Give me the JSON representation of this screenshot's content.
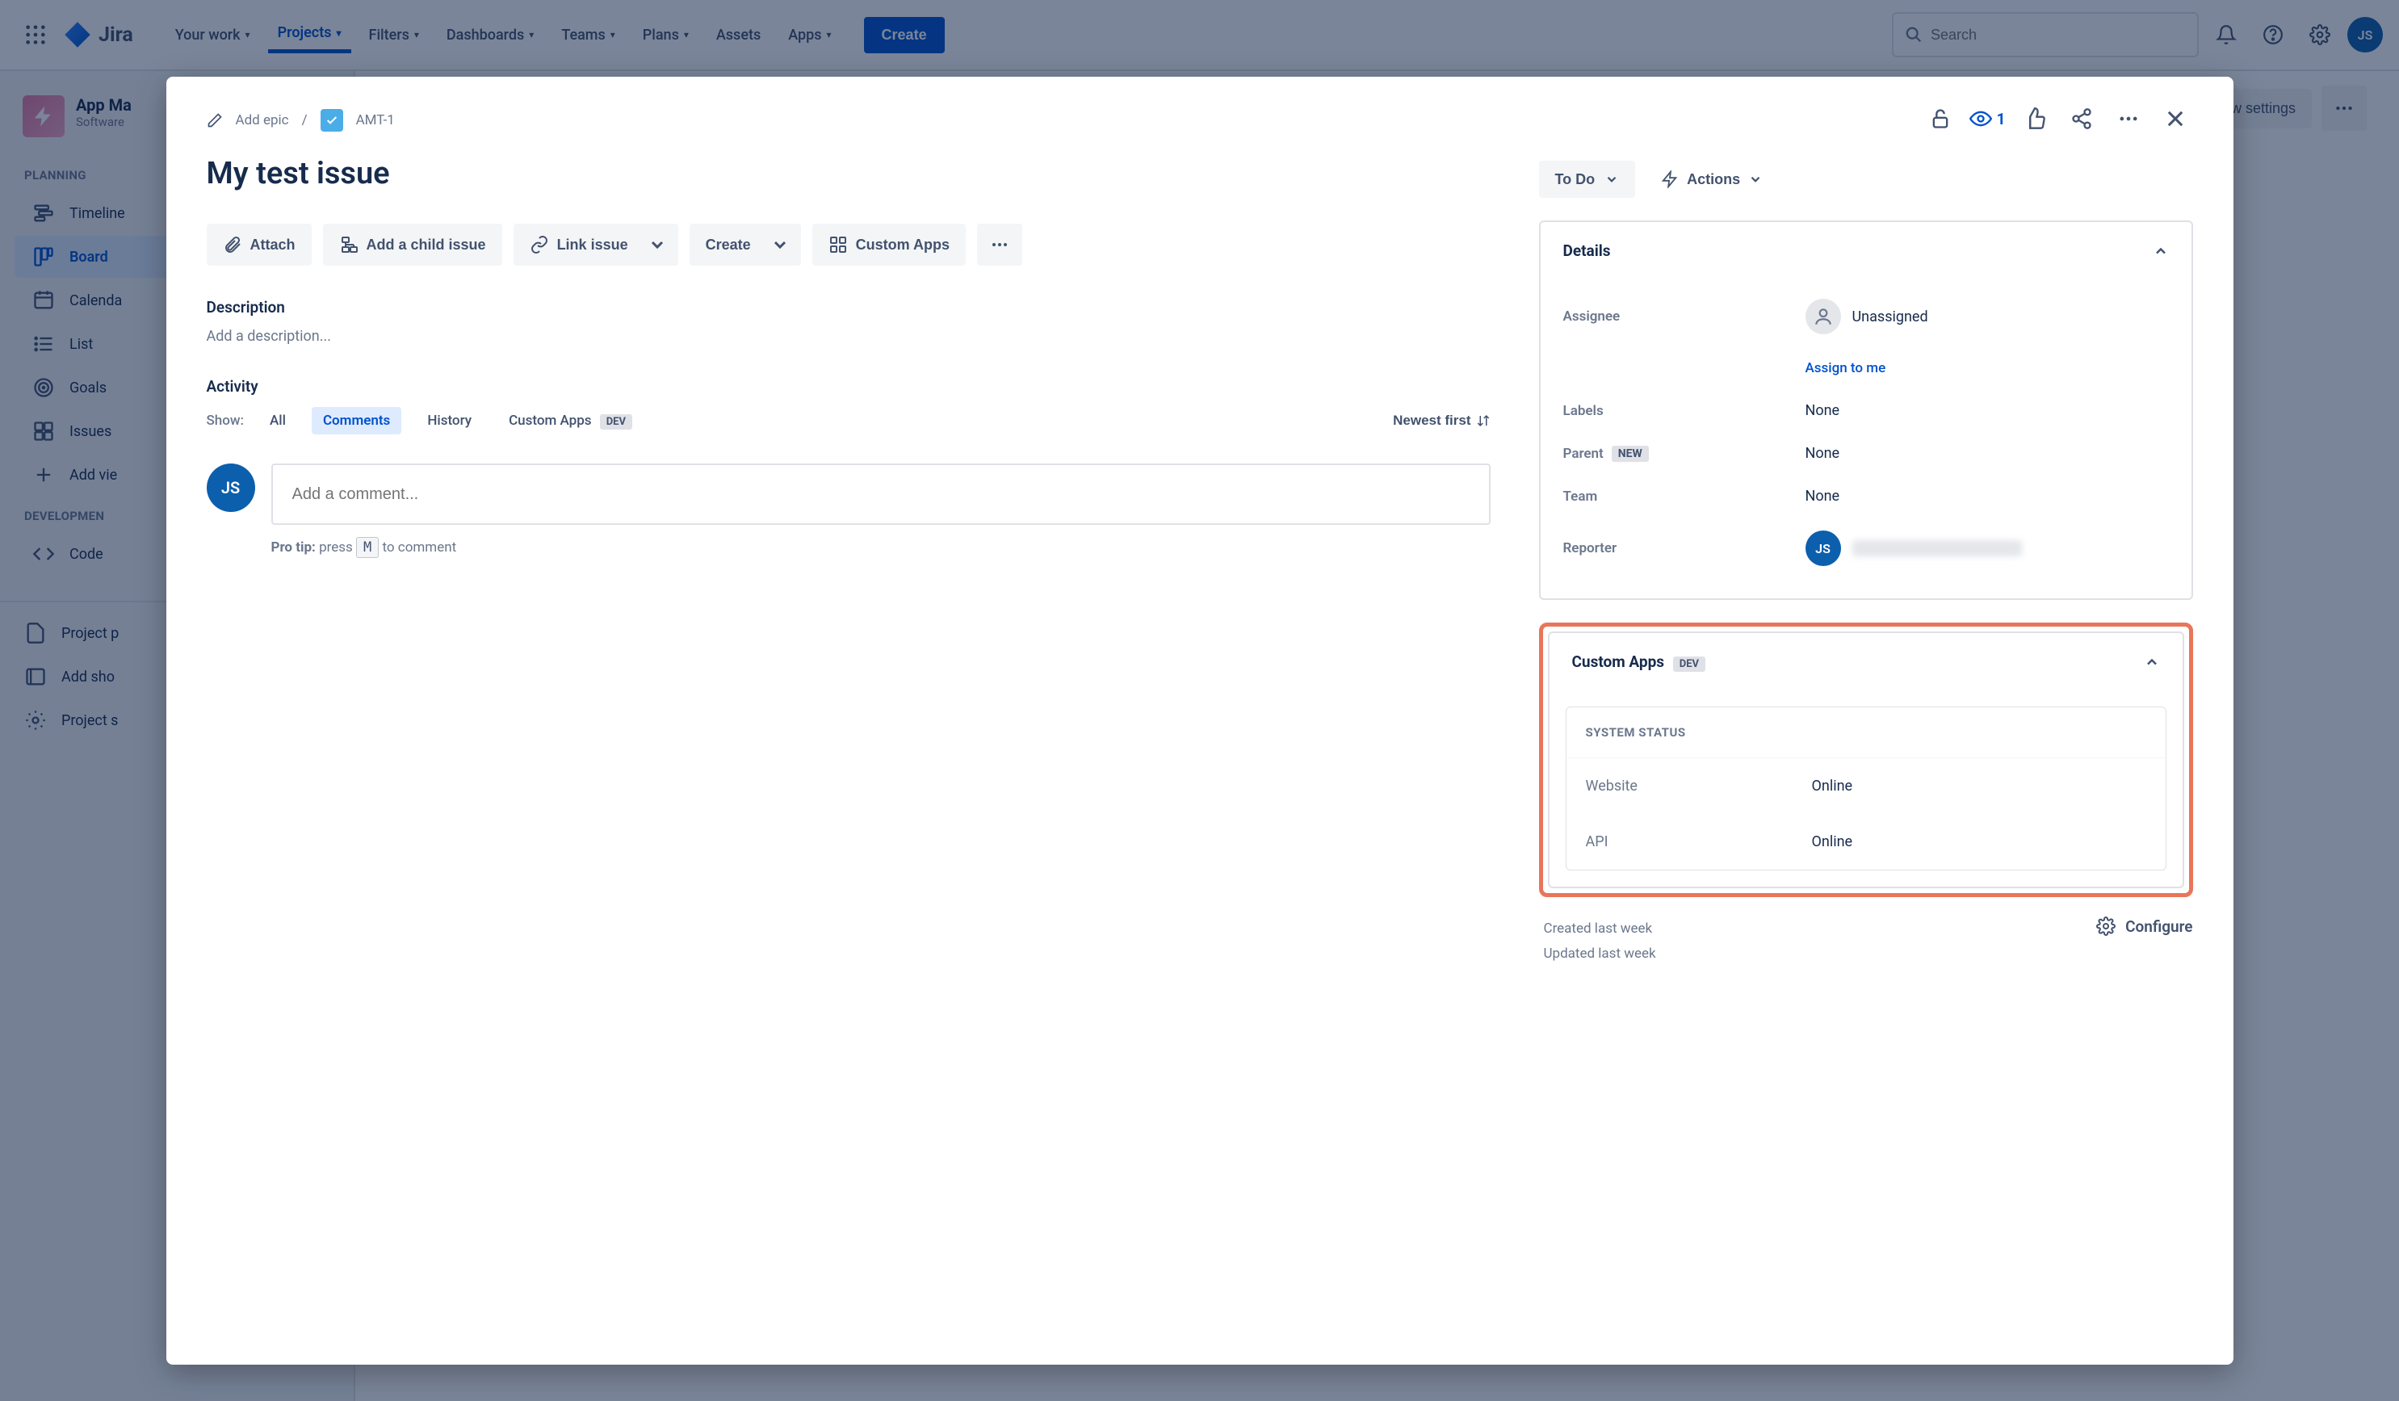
{
  "nav": {
    "logo": "Jira",
    "items": [
      "Your work",
      "Projects",
      "Filters",
      "Dashboards",
      "Teams",
      "Plans",
      "Assets",
      "Apps"
    ],
    "create": "Create",
    "search_placeholder": "Search"
  },
  "sidebar": {
    "project_title": "App Ma",
    "project_sub": "Software ",
    "sections": {
      "planning": "PLANNING",
      "development": "DEVELOPMEN"
    },
    "planning_items": [
      {
        "label": "Timeline"
      },
      {
        "label": "Board"
      },
      {
        "label": "Calenda"
      },
      {
        "label": "List"
      },
      {
        "label": "Goals"
      },
      {
        "label": "Issues"
      }
    ],
    "add_view": "Add vie",
    "development_items": [
      {
        "label": "Code"
      }
    ],
    "footer_items": [
      {
        "label": "Project p"
      },
      {
        "label": "Add sho"
      },
      {
        "label": "Project s"
      }
    ]
  },
  "view_settings": "w settings",
  "modal": {
    "breadcrumb": {
      "add_epic": "Add epic",
      "issue_key": "AMT-1"
    },
    "title": "My test issue",
    "actions": {
      "attach": "Attach",
      "add_child": "Add a child issue",
      "link_issue": "Link issue",
      "create": "Create",
      "custom_apps": "Custom Apps"
    },
    "description_heading": "Description",
    "description_placeholder": "Add a description...",
    "activity_heading": "Activity",
    "activity": {
      "show": "Show:",
      "tabs": [
        "All",
        "Comments",
        "History",
        "Custom Apps"
      ],
      "dev_badge": "DEV",
      "sort": "Newest first"
    },
    "comment": {
      "placeholder": "Add a comment...",
      "pro_tip_a": "Pro tip:",
      "pro_tip_b": "press",
      "pro_tip_key": "M",
      "pro_tip_c": "to comment"
    },
    "top_right": {
      "watch_count": "1"
    },
    "status": "To Do",
    "actions_label": "Actions",
    "details": {
      "header": "Details",
      "assignee_label": "Assignee",
      "assignee_value": "Unassigned",
      "assign_to_me": "Assign to me",
      "labels_label": "Labels",
      "labels_value": "None",
      "parent_label": "Parent",
      "parent_badge": "NEW",
      "parent_value": "None",
      "team_label": "Team",
      "team_value": "None",
      "reporter_label": "Reporter"
    },
    "custom_apps": {
      "header": "Custom Apps",
      "dev_badge": "DEV",
      "system_status": "SYSTEM STATUS",
      "rows": [
        {
          "key": "Website",
          "value": "Online"
        },
        {
          "key": "API",
          "value": "Online"
        }
      ]
    },
    "meta": {
      "created": "Created last week",
      "updated": "Updated last week",
      "configure": "Configure"
    }
  },
  "user_initials": "JS"
}
